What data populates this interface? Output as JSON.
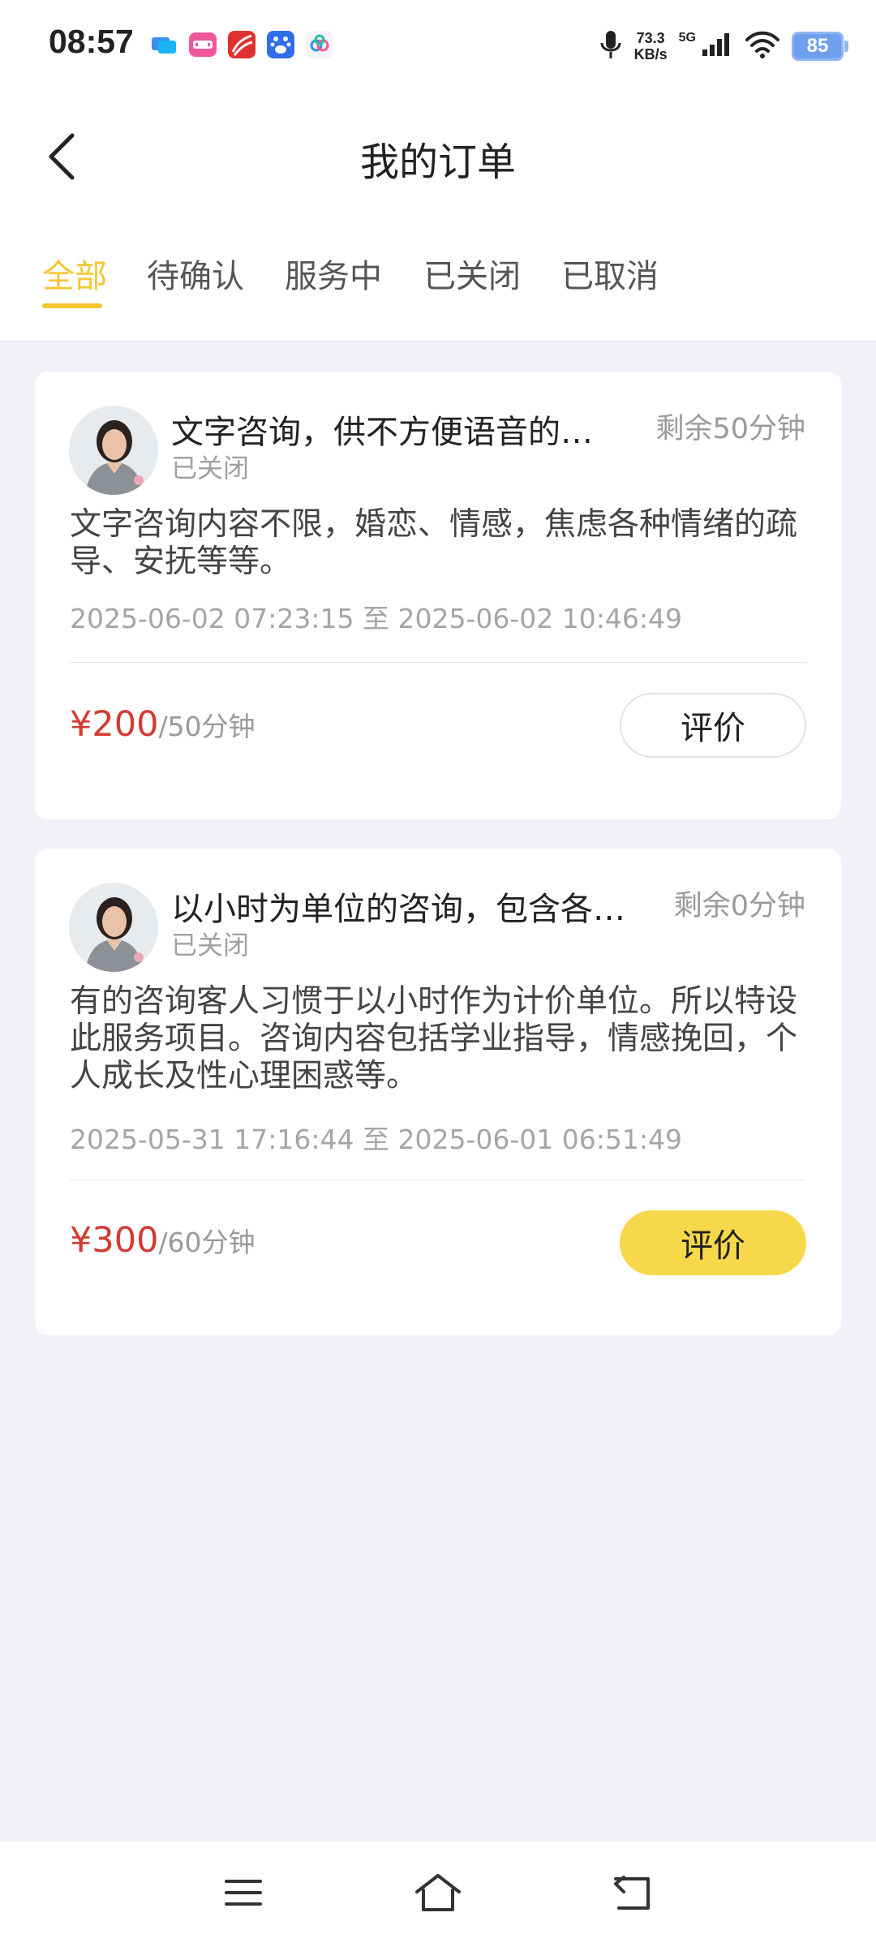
{
  "status_bar": {
    "time": "08:57",
    "speed_value": "73.3",
    "speed_unit": "KB/s",
    "network": "5G",
    "battery": "85"
  },
  "header": {
    "title": "我的订单",
    "back_icon": "chevron-left-icon"
  },
  "tabs": [
    {
      "label": "全部",
      "active": true
    },
    {
      "label": "待确认",
      "active": false
    },
    {
      "label": "服务中",
      "active": false
    },
    {
      "label": "已关闭",
      "active": false
    },
    {
      "label": "已取消",
      "active": false
    }
  ],
  "orders": [
    {
      "title": "文字咨询，供不方便语音的…",
      "remaining": "剩余50分钟",
      "status": "已关闭",
      "description": "文字咨询内容不限，婚恋、情感，焦虑各种情绪的疏导、安抚等等。",
      "time_range": "2025-06-02 07:23:15 至 2025-06-02 10:46:49",
      "price": "¥200",
      "price_unit": "/50分钟",
      "action_label": "评价"
    },
    {
      "title": "以小时为单位的咨询，包含各…",
      "remaining": "剩余0分钟",
      "status": "已关闭",
      "description": "有的咨询客人习惯于以小时作为计价单位。所以特设此服务项目。咨询内容包括学业指导，情感挽回，个人成长及性心理困惑等。",
      "time_range": "2025-05-31 17:16:44 至 2025-06-01 06:51:49",
      "price": "¥300",
      "price_unit": "/60分钟",
      "action_label": "评价"
    }
  ],
  "colors": {
    "accent": "#f5c631",
    "price": "#d33b32",
    "background": "#f1f2f7",
    "button_filled": "#f6d84a"
  },
  "nav_icons": [
    "menu-icon",
    "home-icon",
    "back-icon"
  ]
}
